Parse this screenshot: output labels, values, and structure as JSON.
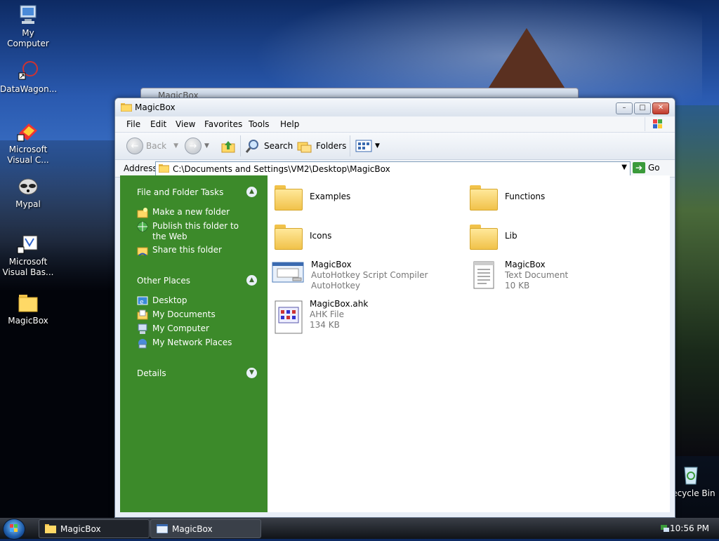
{
  "desktop": {
    "icons": [
      {
        "label": "My Computer"
      },
      {
        "label": "DataWagon..."
      },
      {
        "label": "Microsoft Visual C..."
      },
      {
        "label": "Mypal"
      },
      {
        "label": "Microsoft Visual Bas..."
      },
      {
        "label": "MagicBox"
      },
      {
        "label": "Recycle Bin"
      }
    ]
  },
  "ghost_window": {
    "title": "MagicBox"
  },
  "window": {
    "title": "MagicBox",
    "menu": [
      "File",
      "Edit",
      "View",
      "Favorites",
      "Tools",
      "Help"
    ],
    "toolbar": {
      "back": "Back",
      "search": "Search",
      "folders": "Folders"
    },
    "address": {
      "label": "Address",
      "value": "C:\\Documents and Settings\\VM2\\Desktop\\MagicBox",
      "go": "Go"
    },
    "taskpane": {
      "file_tasks": {
        "title": "File and Folder Tasks",
        "items": [
          "Make a new folder",
          "Publish this folder to the Web",
          "Share this folder"
        ]
      },
      "other_places": {
        "title": "Other Places",
        "items": [
          "Desktop",
          "My Documents",
          "My Computer",
          "My Network Places"
        ]
      },
      "details": {
        "title": "Details"
      }
    },
    "files": [
      {
        "name": "Examples",
        "type": "folder"
      },
      {
        "name": "Functions",
        "type": "folder"
      },
      {
        "name": "Icons",
        "type": "folder"
      },
      {
        "name": "Lib",
        "type": "folder"
      },
      {
        "name": "MagicBox",
        "line2": "AutoHotkey Script Compiler",
        "line3": "AutoHotkey",
        "type": "exe"
      },
      {
        "name": "MagicBox",
        "line2": "Text Document",
        "line3": "10 KB",
        "type": "txt"
      },
      {
        "name": "MagicBox.ahk",
        "line2": "AHK File",
        "line3": "134 KB",
        "type": "ahk"
      }
    ]
  },
  "taskbar": {
    "items": [
      "MagicBox",
      "MagicBox"
    ],
    "clock": "10:56 PM"
  }
}
